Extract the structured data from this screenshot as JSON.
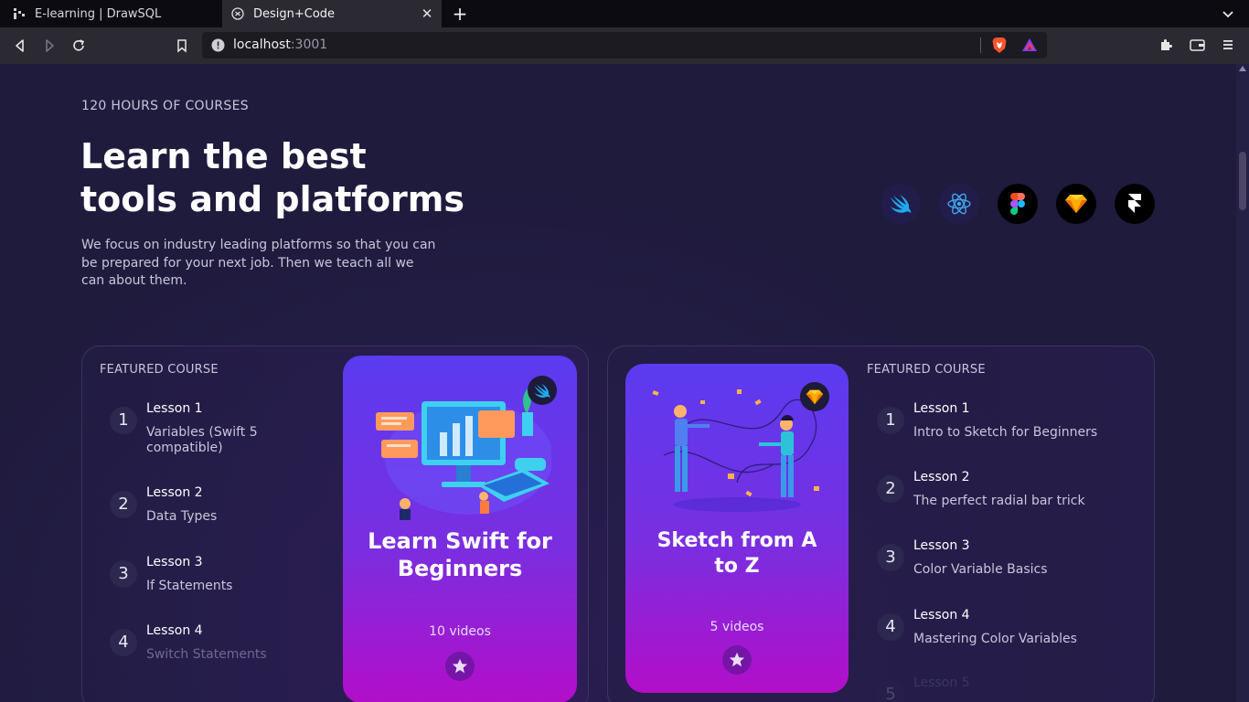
{
  "browser": {
    "tabs": [
      {
        "label": "E-learning | DrawSQL",
        "active": false
      },
      {
        "label": "Design+Code",
        "active": true
      }
    ],
    "url": {
      "host": "localhost",
      "port": ":3001"
    }
  },
  "hero": {
    "eyebrow": "120 HOURS OF COURSES",
    "headline": "Learn the best tools and platforms",
    "lead": "We focus on industry leading platforms so that you can be prepared for your next job. Then we teach all we can about them.",
    "platform_icons": [
      "swift-icon",
      "react-icon",
      "figma-icon",
      "sketch-icon",
      "framer-icon"
    ]
  },
  "featured_left": {
    "label": "FEATURED COURSE",
    "lessons": [
      {
        "num": "1",
        "title": "Lesson 1",
        "sub": "Variables (Swift 5 compatible)"
      },
      {
        "num": "2",
        "title": "Lesson 2",
        "sub": "Data Types"
      },
      {
        "num": "3",
        "title": "Lesson 3",
        "sub": "If Statements"
      },
      {
        "num": "4",
        "title": "Lesson 4",
        "sub": "Switch Statements"
      }
    ],
    "card": {
      "title": "Learn Swift for Beginners",
      "count": "10 videos",
      "badge_icon": "swift-icon"
    }
  },
  "featured_right": {
    "label": "FEATURED COURSE",
    "lessons": [
      {
        "num": "1",
        "title": "Lesson 1",
        "sub": "Intro to Sketch for Beginners"
      },
      {
        "num": "2",
        "title": "Lesson 2",
        "sub": "The perfect radial bar trick"
      },
      {
        "num": "3",
        "title": "Lesson 3",
        "sub": "Color Variable Basics"
      },
      {
        "num": "4",
        "title": "Lesson 4",
        "sub": "Mastering Color Variables"
      },
      {
        "num": "5",
        "title": "Lesson 5",
        "sub": ""
      }
    ],
    "card": {
      "title": "Sketch from A to Z",
      "count": "5 videos",
      "badge_icon": "sketch-icon"
    }
  },
  "colors": {
    "background": "#1f1b3d",
    "card_top": "#5b3bf0",
    "card_bottom": "#b30ec9"
  }
}
